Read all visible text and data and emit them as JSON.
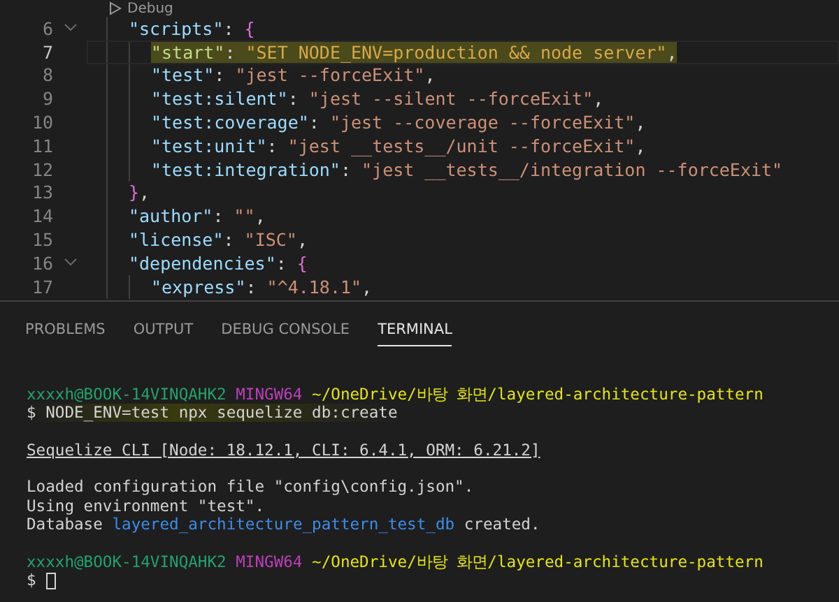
{
  "editor": {
    "codelens": "Debug",
    "lines": [
      {
        "number": "6",
        "fold": true,
        "current": false,
        "tokens": [
          {
            "kind": "key",
            "text": "\"scripts\""
          },
          {
            "kind": "punct",
            "text": ": "
          },
          {
            "kind": "bracket",
            "text": "{"
          }
        ],
        "children": [
          {
            "number": "7",
            "fold": false,
            "current": true,
            "tokens": [
              {
                "kind": "key",
                "text": "\"start\""
              },
              {
                "kind": "punct",
                "text": ": "
              },
              {
                "kind": "string",
                "text": "\"SET NODE_ENV=production && node server\""
              },
              {
                "kind": "punct",
                "text": ","
              }
            ]
          },
          {
            "number": "8",
            "fold": false,
            "current": false,
            "tokens": [
              {
                "kind": "key",
                "text": "\"test\""
              },
              {
                "kind": "punct",
                "text": ": "
              },
              {
                "kind": "string",
                "text": "\"jest --forceExit\""
              },
              {
                "kind": "punct",
                "text": ","
              }
            ]
          },
          {
            "number": "9",
            "fold": false,
            "current": false,
            "tokens": [
              {
                "kind": "key",
                "text": "\"test:silent\""
              },
              {
                "kind": "punct",
                "text": ": "
              },
              {
                "kind": "string",
                "text": "\"jest --silent --forceExit\""
              },
              {
                "kind": "punct",
                "text": ","
              }
            ]
          },
          {
            "number": "10",
            "fold": false,
            "current": false,
            "tokens": [
              {
                "kind": "key",
                "text": "\"test:coverage\""
              },
              {
                "kind": "punct",
                "text": ": "
              },
              {
                "kind": "string",
                "text": "\"jest --coverage --forceExit\""
              },
              {
                "kind": "punct",
                "text": ","
              }
            ]
          },
          {
            "number": "11",
            "fold": false,
            "current": false,
            "tokens": [
              {
                "kind": "key",
                "text": "\"test:unit\""
              },
              {
                "kind": "punct",
                "text": ": "
              },
              {
                "kind": "string",
                "text": "\"jest __tests__/unit --forceExit\""
              },
              {
                "kind": "punct",
                "text": ","
              }
            ]
          },
          {
            "number": "12",
            "fold": false,
            "current": false,
            "tokens": [
              {
                "kind": "key",
                "text": "\"test:integration\""
              },
              {
                "kind": "punct",
                "text": ": "
              },
              {
                "kind": "string",
                "text": "\"jest __tests__/integration --forceExit\""
              }
            ]
          }
        ]
      },
      {
        "number": "13",
        "fold": false,
        "current": false,
        "tokens": [
          {
            "kind": "bracket",
            "text": "}"
          },
          {
            "kind": "punct",
            "text": ","
          }
        ]
      },
      {
        "number": "14",
        "fold": false,
        "current": false,
        "tokens": [
          {
            "kind": "key",
            "text": "\"author\""
          },
          {
            "kind": "punct",
            "text": ": "
          },
          {
            "kind": "string",
            "text": "\"\""
          },
          {
            "kind": "punct",
            "text": ","
          }
        ]
      },
      {
        "number": "15",
        "fold": false,
        "current": false,
        "tokens": [
          {
            "kind": "key",
            "text": "\"license\""
          },
          {
            "kind": "punct",
            "text": ": "
          },
          {
            "kind": "string",
            "text": "\"ISC\""
          },
          {
            "kind": "punct",
            "text": ","
          }
        ]
      },
      {
        "number": "16",
        "fold": true,
        "current": false,
        "tokens": [
          {
            "kind": "key",
            "text": "\"dependencies\""
          },
          {
            "kind": "punct",
            "text": ": "
          },
          {
            "kind": "bracket",
            "text": "{"
          }
        ],
        "children": [
          {
            "number": "17",
            "fold": false,
            "current": false,
            "tokens": [
              {
                "kind": "key",
                "text": "\"express\""
              },
              {
                "kind": "punct",
                "text": ": "
              },
              {
                "kind": "string",
                "text": "\"^4.18.1\""
              },
              {
                "kind": "punct",
                "text": ","
              }
            ]
          }
        ]
      }
    ]
  },
  "panel": {
    "tabs": [
      {
        "label": "PROBLEMS",
        "selected": false
      },
      {
        "label": "OUTPUT",
        "selected": false
      },
      {
        "label": "DEBUG CONSOLE",
        "selected": false
      },
      {
        "label": "TERMINAL",
        "selected": true
      }
    ],
    "terminal": {
      "lines": [
        {
          "kind": "text",
          "segments": [
            {
              "kind": "user",
              "text": "xxxxh@BOOK-14VINQAHK2"
            },
            {
              "kind": "host",
              "text": " MINGW64"
            },
            {
              "kind": "path",
              "text": " ~/OneDrive/바탕 화면/layered-architecture-pattern"
            }
          ]
        },
        {
          "kind": "text",
          "segments": [
            {
              "kind": "command",
              "text": "$ NODE_ENV=test npx sequelize db:create"
            }
          ]
        },
        {
          "kind": "blank"
        },
        {
          "kind": "text",
          "segments": [
            {
              "kind": "underline",
              "text": "Sequelize CLI [Node: 18.12.1, CLI: 6.4.1, ORM: 6.21.2]"
            }
          ]
        },
        {
          "kind": "blank"
        },
        {
          "kind": "text",
          "segments": [
            {
              "kind": "plain",
              "text": "Loaded configuration file \"config\\config.json\"."
            }
          ]
        },
        {
          "kind": "text",
          "segments": [
            {
              "kind": "plain",
              "text": "Using environment \"test\"."
            }
          ]
        },
        {
          "kind": "text",
          "segments": [
            {
              "kind": "plain",
              "text": "Database "
            },
            {
              "kind": "link",
              "text": "layered_architecture_pattern_test_db"
            },
            {
              "kind": "plain",
              "text": " created."
            }
          ]
        },
        {
          "kind": "blank"
        },
        {
          "kind": "text",
          "segments": [
            {
              "kind": "user",
              "text": "xxxxh@BOOK-14VINQAHK2"
            },
            {
              "kind": "host",
              "text": " MINGW64"
            },
            {
              "kind": "path",
              "text": " ~/OneDrive/바탕 화면/layered-architecture-pattern"
            }
          ]
        },
        {
          "kind": "text",
          "segments": [
            {
              "kind": "plain",
              "text": "$ "
            },
            {
              "kind": "cursor"
            }
          ]
        }
      ]
    }
  }
}
